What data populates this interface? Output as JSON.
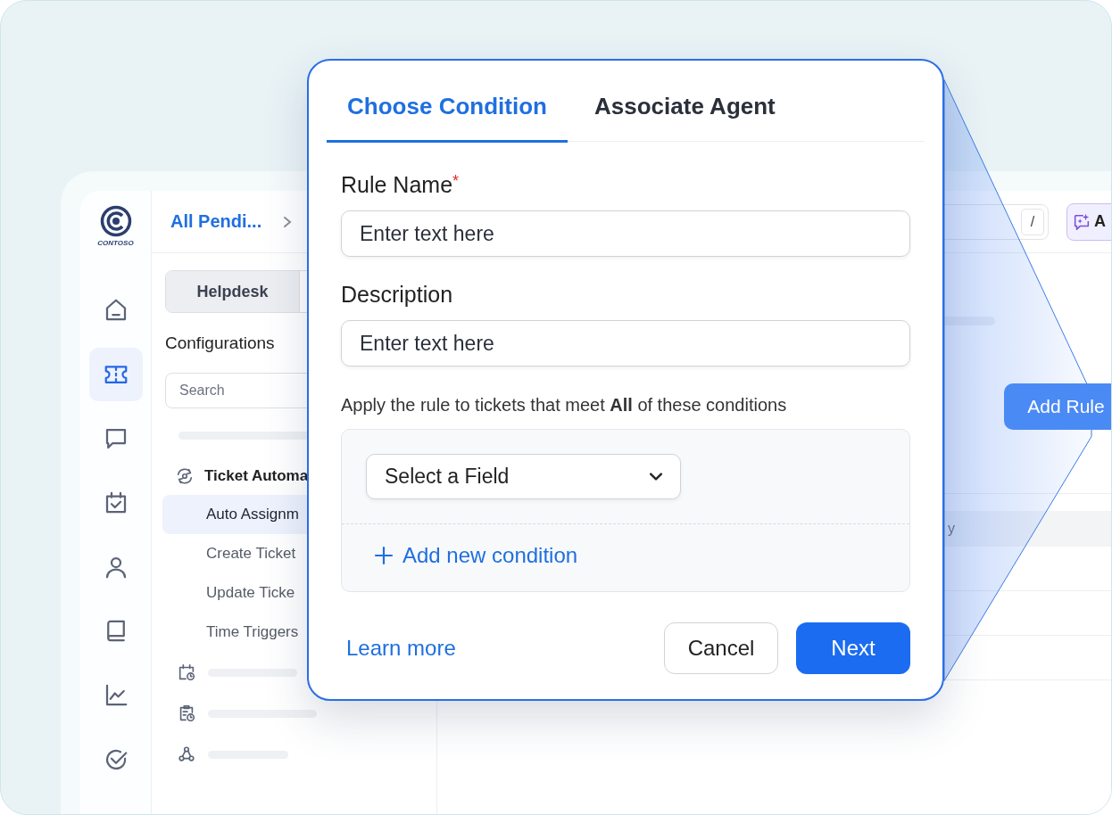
{
  "brand": {
    "logo_text": "CONTOSO"
  },
  "nav_rail": {
    "items": [
      {
        "selected": false
      },
      {
        "selected": true
      },
      {
        "selected": false
      },
      {
        "selected": false
      },
      {
        "selected": false
      },
      {
        "selected": false
      },
      {
        "selected": false
      },
      {
        "selected": false
      }
    ]
  },
  "panel": {
    "title": "All Pendi...",
    "tabs": [
      {
        "label": "Helpdesk",
        "selected": true
      }
    ],
    "section_title": "Configurations",
    "search": {
      "placeholder": "Search"
    },
    "tree": [
      {
        "label": "Ticket Automa",
        "children": [
          {
            "label": "Auto Assignm",
            "selected": true
          },
          {
            "label": "Create Ticket",
            "selected": false
          },
          {
            "label": "Update Ticke",
            "selected": false
          },
          {
            "label": "Time Triggers",
            "selected": false
          }
        ]
      }
    ]
  },
  "main": {
    "search_shortcut": "/",
    "ai_button": {
      "label": "A"
    },
    "add_rule_button": "Add Rule",
    "table": {
      "columns": [
        "y"
      ]
    }
  },
  "modal": {
    "tabs": [
      {
        "label": "Choose Condition",
        "selected": true
      },
      {
        "label": "Associate Agent",
        "selected": false
      }
    ],
    "fields": [
      {
        "label": "Rule Name",
        "required_mark": "*",
        "placeholder": "Enter text here"
      },
      {
        "label": "Description",
        "placeholder": "Enter text here"
      }
    ],
    "condition_sentence": "Apply the rule to tickets that meet **All** of these conditions",
    "condition_builder": {
      "field_select": {
        "placeholder": "Select a Field"
      },
      "add_link": "Add new condition"
    },
    "learn_more": "Learn more",
    "buttons": [
      {
        "label": "Cancel",
        "kind": "secondary"
      },
      {
        "label": "Next",
        "kind": "primary"
      }
    ]
  }
}
